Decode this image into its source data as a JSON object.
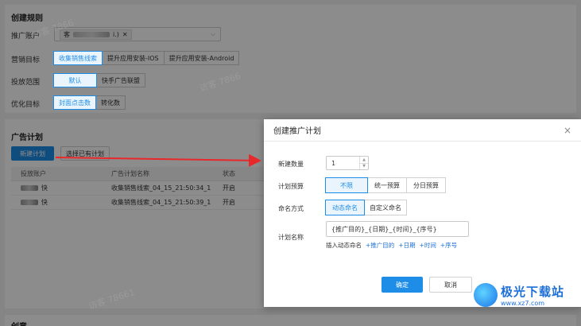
{
  "section1": {
    "title": "创建规则",
    "account_label": "推广账户",
    "account_tag_prefix": "客",
    "account_tag_suffix": "i.)",
    "goal_label": "营销目标",
    "goal_options": [
      "收集销售线索",
      "提升应用安装-IOS",
      "提升应用安装-Android"
    ],
    "scope_label": "投放范围",
    "scope_options": [
      "默认",
      "快手广告联盟"
    ],
    "optimize_label": "优化目标",
    "optimize_options": [
      "封面点击数",
      "转化数"
    ]
  },
  "section2": {
    "title": "广告计划",
    "new_plan_button": "新建计划",
    "select_existing_button": "选择已有计划",
    "columns": [
      "投放账户",
      "广告计划名称",
      "状态"
    ],
    "rows": [
      {
        "account_suffix": "快",
        "plan_name": "收集销售线索_04_15_21:50:34_1",
        "status": "开启"
      },
      {
        "account_suffix": "快",
        "plan_name": "收集销售线索_04_15_21:50:39_1",
        "status": "开启"
      }
    ]
  },
  "section3": {
    "title": "创意..."
  },
  "modal": {
    "title": "创建推广计划",
    "close_icon": "×",
    "quantity_label": "新建数量",
    "quantity_value": "1",
    "budget_label": "计划预算",
    "budget_options": [
      "不限",
      "统一预算",
      "分日预算"
    ],
    "naming_label": "命名方式",
    "naming_options": [
      "动态命名",
      "自定义命名"
    ],
    "plan_name_label": "计划名称",
    "plan_name_value": "{推广目的}_{日期}_{时间}_{序号}",
    "insert_label": "插入动态命名",
    "insert_links": [
      "+推广目的",
      "+日期",
      "+时间",
      "+序号"
    ],
    "confirm_button": "确定",
    "cancel_button": "取消"
  },
  "watermarks": [
    "访客 7866",
    "访客 78661"
  ],
  "logo": {
    "name": "极光下载站",
    "url": "www.xz7.com"
  },
  "colors": {
    "accent": "#1d8de8",
    "arrow": "#e8282b"
  }
}
